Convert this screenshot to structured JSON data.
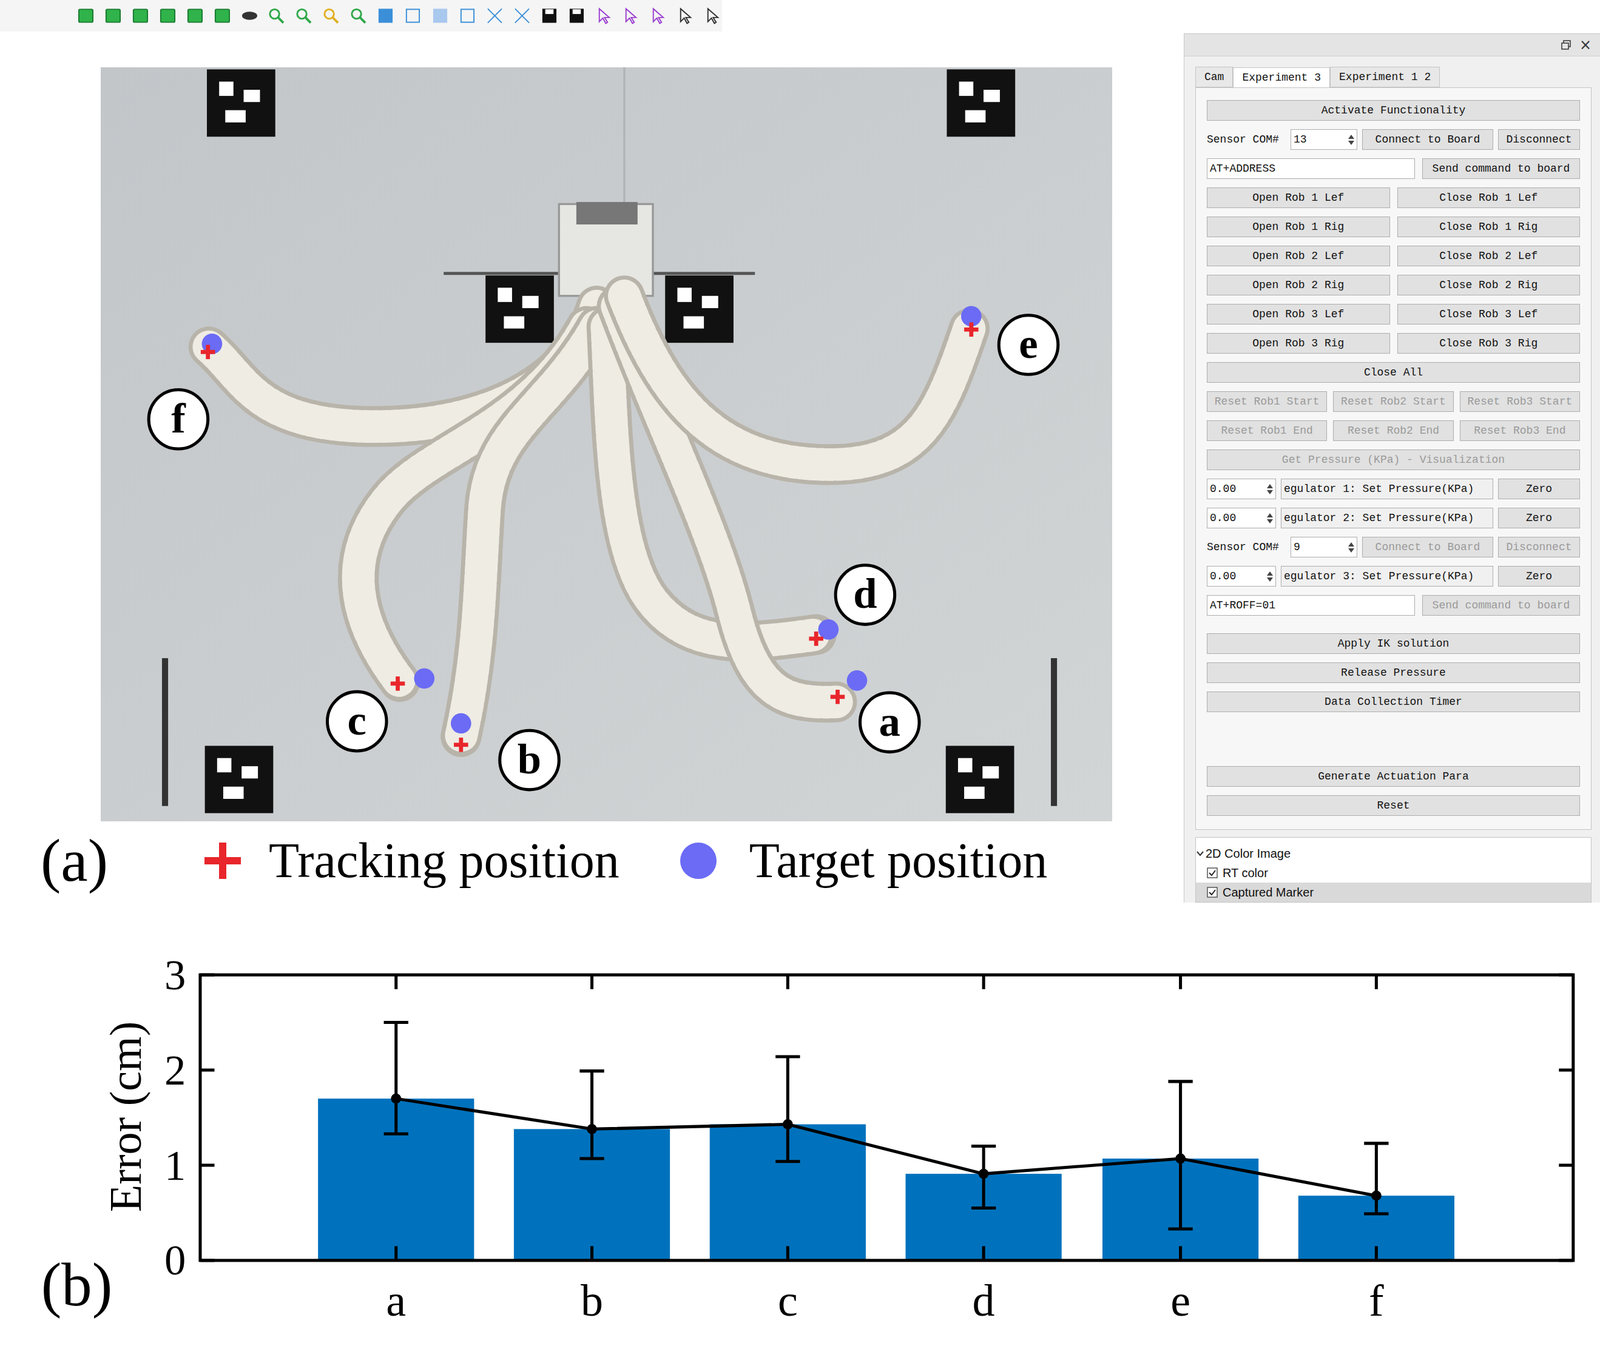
{
  "figure_a": {
    "label": "(a)",
    "points": [
      {
        "label": "a"
      },
      {
        "label": "b"
      },
      {
        "label": "c"
      },
      {
        "label": "d"
      },
      {
        "label": "e"
      },
      {
        "label": "f"
      }
    ],
    "legend": [
      {
        "label": "Tracking position",
        "color": "#e8262b"
      },
      {
        "label": "Target position",
        "color": "#6b6bf5"
      }
    ]
  },
  "panel": {
    "window_close": "×",
    "tabs": [
      {
        "label": "Cam",
        "selected": false
      },
      {
        "label": "Experiment 3",
        "selected": true
      },
      {
        "label": "Experiment 1 2",
        "selected": false
      }
    ],
    "sections": [
      [
        {
          "kind": "button",
          "label": "Activate Functionality",
          "disabled": false
        },
        {
          "kind": "com",
          "label": "Sensor COM#",
          "value": "13",
          "buttons": [
            {
              "label": "Connect to Board",
              "disabled": false
            },
            {
              "label": "Disconnect",
              "disabled": false
            }
          ]
        },
        {
          "kind": "command",
          "value": "AT+ADDRESS",
          "button": {
            "label": "Send command to board",
            "disabled": false
          }
        },
        {
          "kind": "pair",
          "buttons": [
            {
              "label": "Open Rob 1 Lef",
              "disabled": false
            },
            {
              "label": "Close Rob 1 Lef",
              "disabled": false
            }
          ]
        },
        {
          "kind": "pair",
          "buttons": [
            {
              "label": "Open Rob 1 Rig",
              "disabled": false
            },
            {
              "label": "Close Rob 1 Rig",
              "disabled": false
            }
          ]
        },
        {
          "kind": "pair",
          "buttons": [
            {
              "label": "Open Rob 2 Lef",
              "disabled": false
            },
            {
              "label": "Close Rob 2 Lef",
              "disabled": false
            }
          ]
        },
        {
          "kind": "pair",
          "buttons": [
            {
              "label": "Open Rob 2 Rig",
              "disabled": false
            },
            {
              "label": "Close Rob 2 Rig",
              "disabled": false
            }
          ]
        },
        {
          "kind": "pair",
          "buttons": [
            {
              "label": "Open Rob 3 Lef",
              "disabled": false
            },
            {
              "label": "Close Rob 3 Lef",
              "disabled": false
            }
          ]
        },
        {
          "kind": "pair",
          "buttons": [
            {
              "label": "Open Rob 3 Rig",
              "disabled": false
            },
            {
              "label": "Close Rob 3 Rig",
              "disabled": false
            }
          ]
        },
        {
          "kind": "button",
          "label": "Close All",
          "disabled": false
        },
        {
          "kind": "triple",
          "buttons": [
            {
              "label": "Reset Rob1 Start",
              "disabled": true
            },
            {
              "label": "Reset Rob2 Start",
              "disabled": true
            },
            {
              "label": "Reset Rob3 Start",
              "disabled": true
            }
          ]
        },
        {
          "kind": "triple",
          "buttons": [
            {
              "label": "Reset Rob1 End",
              "disabled": true
            },
            {
              "label": "Reset Rob2 End",
              "disabled": true
            },
            {
              "label": "Reset Rob3 End",
              "disabled": true
            }
          ]
        },
        {
          "kind": "button",
          "label": "Get Pressure (KPa) - Visualization",
          "disabled": true
        },
        {
          "kind": "regulator",
          "value": "0.00",
          "label": "egulator 1: Set Pressure(KPa)",
          "button": {
            "label": "Zero",
            "disabled": false
          }
        },
        {
          "kind": "regulator",
          "value": "0.00",
          "label": "egulator 2: Set Pressure(KPa)",
          "button": {
            "label": "Zero",
            "disabled": false
          }
        },
        {
          "kind": "com",
          "label": "Sensor COM#",
          "value": "9",
          "buttons": [
            {
              "label": "Connect to Board",
              "disabled": true
            },
            {
              "label": "Disconnect",
              "disabled": true
            }
          ]
        },
        {
          "kind": "regulator",
          "value": "0.00",
          "label": "egulator 3: Set Pressure(KPa)",
          "button": {
            "label": "Zero",
            "disabled": false
          }
        },
        {
          "kind": "command",
          "value": "AT+ROFF=01",
          "button": {
            "label": "Send command to board",
            "disabled": true
          }
        }
      ],
      [
        {
          "kind": "button",
          "label": "Apply IK solution",
          "disabled": false
        },
        {
          "kind": "button",
          "label": "Release Pressure",
          "disabled": false
        },
        {
          "kind": "button",
          "label": "Data Collection Timer",
          "disabled": false
        }
      ],
      [
        {
          "kind": "button",
          "label": "Generate Actuation Para",
          "disabled": false
        },
        {
          "kind": "button",
          "label": "Reset",
          "disabled": false
        }
      ]
    ],
    "tree": {
      "label": "2D Color Image",
      "expanded": true,
      "items": [
        {
          "label": "RT color",
          "checked": true,
          "selected": false
        },
        {
          "label": "Captured Marker",
          "checked": true,
          "selected": true
        }
      ]
    }
  },
  "figure_b": {
    "label": "(b)",
    "y_label": "Error (cm)",
    "y_ticks": [
      "0",
      "1",
      "2",
      "3"
    ],
    "categories": [
      "a",
      "b",
      "c",
      "d",
      "e",
      "f"
    ],
    "mean": [
      1.7,
      1.38,
      1.43,
      0.91,
      1.07,
      0.68
    ],
    "error_low": [
      1.33,
      1.07,
      1.04,
      0.55,
      0.33,
      0.49
    ],
    "error_high": [
      2.5,
      1.99,
      2.14,
      1.2,
      1.88,
      1.23
    ]
  }
}
